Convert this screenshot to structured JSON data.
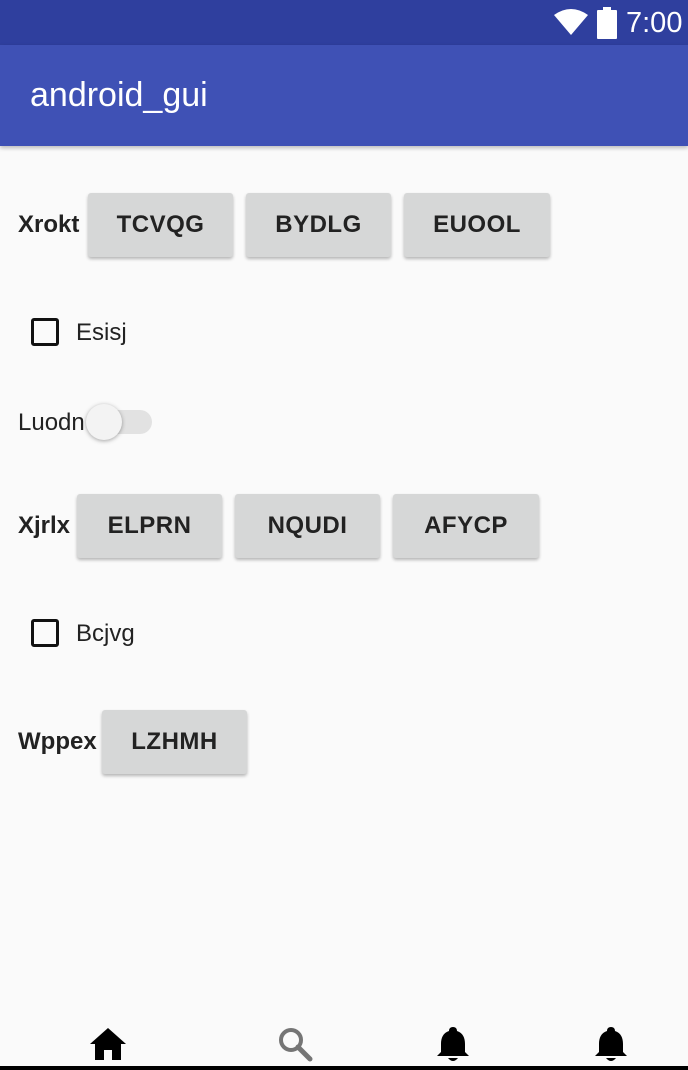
{
  "status_bar": {
    "time": "7:00"
  },
  "app_bar": {
    "title": "android_gui"
  },
  "rows": {
    "row1": {
      "label": "Xrokt",
      "buttons": [
        "TCVQG",
        "BYDLG",
        "EUOOL"
      ]
    },
    "checkbox1": {
      "label": "Esisj",
      "checked": false
    },
    "switch1": {
      "label": "Luodn",
      "on": false
    },
    "row2": {
      "label": "Xjrlx",
      "buttons": [
        "ELPRN",
        "NQUDI",
        "AFYCP"
      ]
    },
    "checkbox2": {
      "label": "Bcjvg",
      "checked": false
    },
    "row3": {
      "label": "Wppex",
      "buttons": [
        "LZHMH"
      ]
    }
  },
  "bottom_nav": {
    "items": [
      "home-icon",
      "search-icon",
      "notifications-icon",
      "notifications-icon"
    ],
    "active_color": "#000000",
    "inactive_color": "#757575"
  },
  "colors": {
    "status_bar": "#2f3f9e",
    "app_bar": "#3f51b5",
    "button": "#d6d7d7"
  }
}
